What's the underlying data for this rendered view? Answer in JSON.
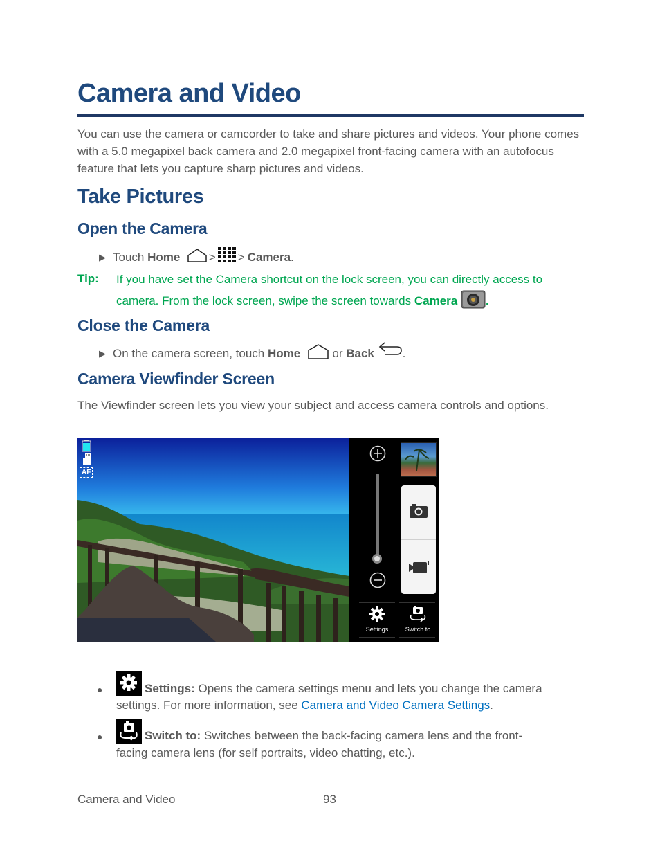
{
  "page": {
    "title": "Camera and Video",
    "intro": "You can use the camera or camcorder to take and share pictures and videos. Your phone comes with a 5.0 megapixel back camera and 2.0 megapixel front-facing camera with an autofocus feature that lets you capture sharp pictures and videos.",
    "section_take_pictures": "Take Pictures",
    "open_camera": {
      "heading": "Open the Camera",
      "step_prefix": "Touch",
      "home_label": "Home",
      "separator": ">",
      "camera_label": "Camera",
      "period": "."
    },
    "tip": {
      "label": "Tip:",
      "text_line1": "If you have set the Camera shortcut on the lock screen, you can directly access to",
      "text_line2_prefix": "camera. From the lock screen, swipe the screen towards",
      "camera_label": "Camera",
      "period": "."
    },
    "close_camera": {
      "heading": "Close the Camera",
      "step_prefix": "On the camera screen, touch",
      "home_label": "Home",
      "or": "or",
      "back_label": "Back",
      "period": "."
    },
    "viewfinder": {
      "heading": "Camera Viewfinder Screen",
      "description": "The Viewfinder screen lets you view your subject and access camera controls and options.",
      "screen": {
        "af_label": "AF",
        "settings_label": "Settings",
        "switch_label": "Switch to",
        "zoom_level": 0
      }
    },
    "bullets": [
      {
        "label": "Settings:",
        "text": "Opens the camera settings menu and lets you change the camera settings. For more information, see",
        "link": "Camera and Video Camera Settings",
        "suffix": "."
      },
      {
        "label": "Switch to:",
        "text_line1": "Switches between the back-facing camera lens and the front-",
        "text_line2": "facing camera lens (for self portraits, video chatting, etc.)."
      }
    ],
    "footer": {
      "section": "Camera and Video",
      "page_number": "93"
    }
  },
  "colors": {
    "heading": "#1f497d",
    "tip": "#00a651",
    "link": "#0070c0",
    "body_text": "#595959"
  }
}
